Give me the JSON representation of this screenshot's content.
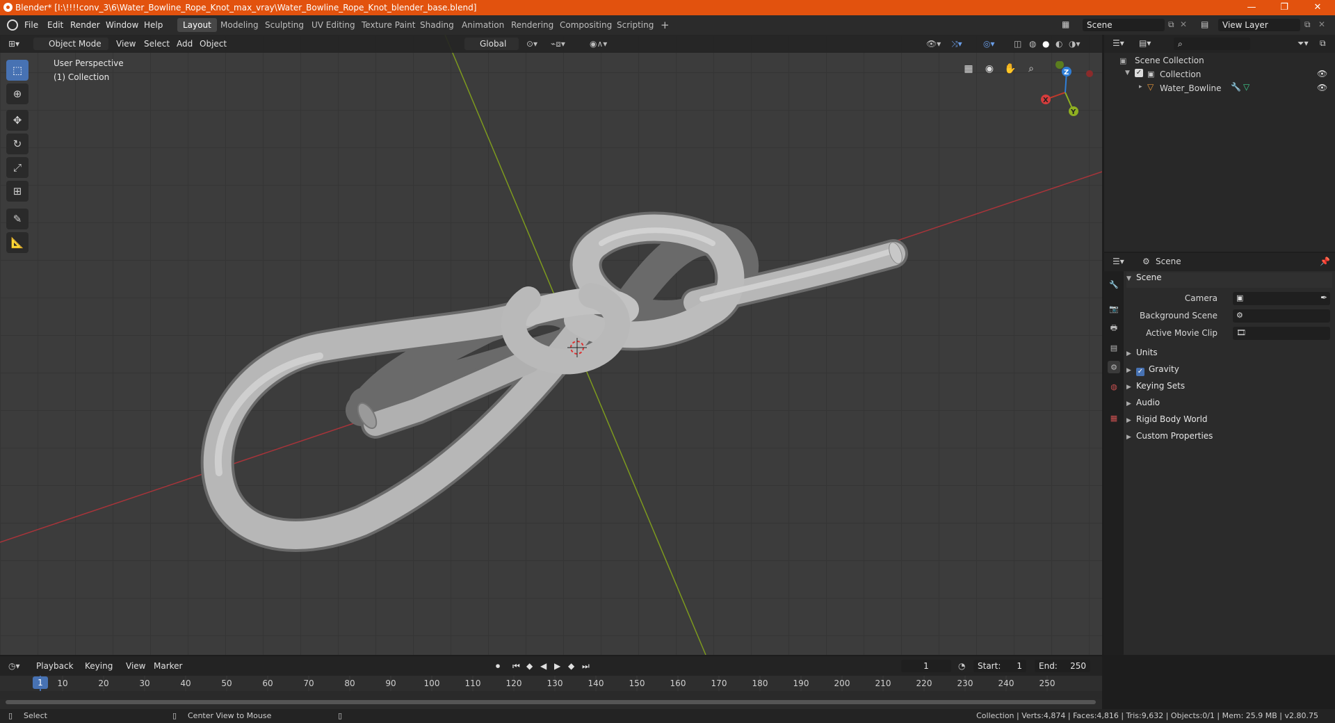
{
  "window": {
    "title": "Blender* [I:\\!!!!conv_3\\6\\Water_Bowline_Rope_Knot_max_vray\\Water_Bowline_Rope_Knot_blender_base.blend]",
    "minimize": "—",
    "maximize": "❐",
    "close": "✕"
  },
  "menu": [
    "File",
    "Edit",
    "Render",
    "Window",
    "Help"
  ],
  "workspaces": [
    "Layout",
    "Modeling",
    "Sculpting",
    "UV Editing",
    "Texture Paint",
    "Shading",
    "Animation",
    "Rendering",
    "Compositing",
    "Scripting"
  ],
  "add_workspace": "+",
  "scene_field": "Scene",
  "view_layer_field": "View Layer",
  "viewport": {
    "mode": "Object Mode",
    "menus": [
      "View",
      "Select",
      "Add",
      "Object"
    ],
    "transform_orientation": "Global",
    "overlay_title": "User Perspective",
    "overlay_collection": "(1) Collection",
    "gizmo_labels": {
      "x": "X",
      "y": "Y",
      "z": "Z"
    }
  },
  "outliner": {
    "root": "Scene Collection",
    "collection": "Collection",
    "object": "Water_Bowline"
  },
  "properties": {
    "context": "Scene",
    "panel_header": "Scene",
    "rows": [
      {
        "label": "Camera"
      },
      {
        "label": "Background Scene"
      },
      {
        "label": "Active Movie Clip"
      }
    ],
    "subpanels": [
      "Units",
      "Gravity",
      "Keying Sets",
      "Audio",
      "Rigid Body World",
      "Custom Properties"
    ]
  },
  "timeline": {
    "menus": [
      "Playback",
      "Keying",
      "View",
      "Marker"
    ],
    "current_frame": "1",
    "start_label": "Start:",
    "start": "1",
    "end_label": "End:",
    "end": "250",
    "ruler": [
      "10",
      "20",
      "30",
      "40",
      "50",
      "60",
      "70",
      "80",
      "90",
      "100",
      "110",
      "120",
      "130",
      "140",
      "150",
      "160",
      "170",
      "180",
      "190",
      "200",
      "210",
      "220",
      "230",
      "240",
      "250"
    ],
    "ruler_current": "1"
  },
  "status": {
    "left_action": "Select",
    "middle_action": "Center View to Mouse",
    "stats": "Collection | Verts:4,874 | Faces:4,816 | Tris:9,632 | Objects:0/1 | Mem: 25.9 MB | v2.80.75"
  },
  "colors": {
    "titlebar": "#e2520e",
    "accent": "#4772b3",
    "x_axis": "#c0392b",
    "y_axis": "#8fb021",
    "z_axis": "#2f7fd8"
  }
}
